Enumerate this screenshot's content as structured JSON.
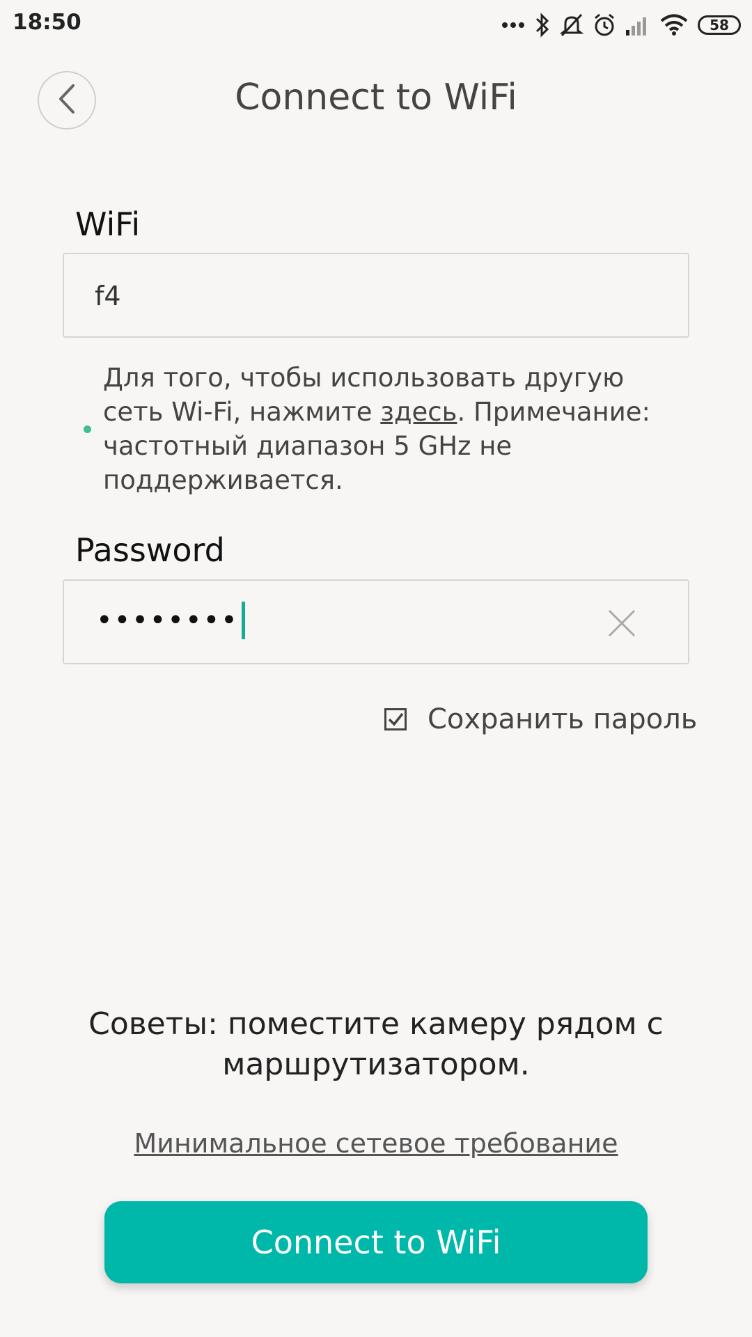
{
  "status_bar": {
    "time": "18:50",
    "battery": "58",
    "icons": [
      "more-dots-icon",
      "bluetooth-icon",
      "mute-icon",
      "alarm-icon",
      "signal-icon",
      "wifi-icon",
      "battery-icon"
    ]
  },
  "header": {
    "title": "Connect to WiFi",
    "back_icon": "chevron-left-icon"
  },
  "wifi": {
    "label": "WiFi",
    "value": "f4"
  },
  "hint": {
    "text_before": "Для того, чтобы использовать другую сеть Wi-Fi, нажмите ",
    "link": "здесь",
    "text_after": ". Примечание: частотный диапазон 5 GHz не поддерживается."
  },
  "password": {
    "label": "Password",
    "value": "••••••••",
    "clear_icon": "close-icon"
  },
  "save_password": {
    "label": "Сохранить пароль",
    "checked": true
  },
  "tips": {
    "text": "Советы: поместите камеру рядом с маршрутизатором."
  },
  "min_requirement_link": "Минимальное сетевое требование",
  "connect_button": "Connect to WiFi",
  "colors": {
    "accent": "#00b8a9",
    "background": "#f7f6f5",
    "cursor": "#18a99a",
    "hint_dot": "#3fbf8f"
  }
}
